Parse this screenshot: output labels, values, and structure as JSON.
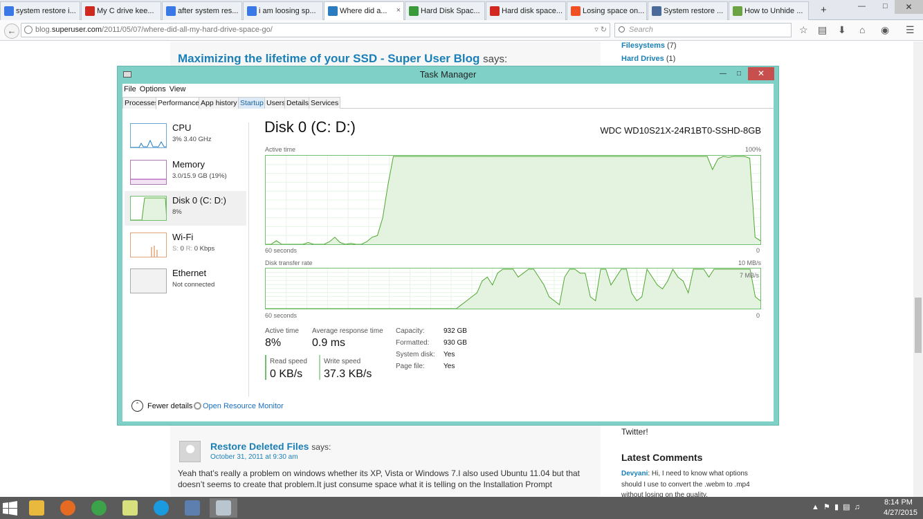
{
  "browser": {
    "tabs": [
      {
        "label": "system restore i...",
        "favicon": "google-icon",
        "color": "#3b78e7"
      },
      {
        "label": "My C drive kee...",
        "favicon": "T-icon",
        "color": "#d0281e"
      },
      {
        "label": "after system res...",
        "favicon": "google-icon",
        "color": "#3b78e7"
      },
      {
        "label": "i am loosing sp...",
        "favicon": "google-icon",
        "color": "#3b78e7"
      },
      {
        "label": "Where did a...",
        "favicon": "superuser-icon",
        "color": "#2a7bbf",
        "active": true
      },
      {
        "label": "Hard Disk Spac...",
        "favicon": "sevenforums-icon",
        "color": "#3a9a3a"
      },
      {
        "label": "Hard disk space...",
        "favicon": "T-icon",
        "color": "#d0281e"
      },
      {
        "label": "Losing space on...",
        "favicon": "microsoft-icon",
        "color": "#f25022"
      },
      {
        "label": "System restore ...",
        "favicon": "page-icon",
        "color": "#4a6b9a"
      },
      {
        "label": "How to Unhide ...",
        "favicon": "wikihow-icon",
        "color": "#6ba342"
      }
    ],
    "active_tab_close": "×",
    "new_tab": "+",
    "url_prefix": "blog.",
    "url_host": "superuser.com",
    "url_path": "/2011/05/07/where-did-all-my-hard-drive-space-go/",
    "search_placeholder": "Search"
  },
  "page": {
    "post_title": "Maximizing the lifetime of your SSD - Super User Blog",
    "post_says": "says:",
    "sidebar_filesystems": "Filesystems",
    "sidebar_filesystems_count": "(7)",
    "sidebar_harddrives": "Hard Drives",
    "sidebar_harddrives_count": "(1)",
    "sidebar_twitter": "Twitter!",
    "latest_comments_heading": "Latest Comments",
    "latest_comment_author": "Devyani",
    "latest_comment_text": ": Hi, I need to know what options should I use to convert the .webm to .mp4 without losing on the quality.",
    "comment_author": "Restore Deleted Files",
    "comment_says": "says:",
    "comment_date": "October 31, 2011 at 9:30 am",
    "comment_text": "Yeah that’s really a problem on windows whether its XP, Vista or Windows 7.I also used Ubuntu 11.04 but that doesn’t seems to create that problem.It just consume space what it is telling on the Installation Prompt"
  },
  "taskmanager": {
    "title": "Task Manager",
    "menu": [
      "File",
      "Options",
      "View"
    ],
    "tabs": [
      "Processes",
      "Performance",
      "App history",
      "Startup",
      "Users",
      "Details",
      "Services"
    ],
    "selected_tab": "Performance",
    "resources": [
      {
        "name": "CPU",
        "sub": "3%  3.40 GHz",
        "color": "#1f7bc0"
      },
      {
        "name": "Memory",
        "sub": "3.0/15.9 GB (19%)",
        "color": "#9c37a6"
      },
      {
        "name": "Disk 0 (C: D:)",
        "sub": "8%",
        "color": "#4ea72e",
        "selected": true
      },
      {
        "name": "Wi-Fi",
        "sub_s": "S:",
        "sub_s_val": "0",
        "sub_r": "R:",
        "sub_r_val": "0 Kbps",
        "color": "#d4793a"
      },
      {
        "name": "Ethernet",
        "sub": "Not connected",
        "color": "#999999"
      }
    ],
    "disk_title": "Disk 0 (C: D:)",
    "disk_model": "WDC WD10S21X-24R1BT0-SSHD-8GB",
    "graph1": {
      "label": "Active time",
      "max_label": "100%",
      "time_label": "60 seconds",
      "min_label": "0",
      "series": [
        0,
        0,
        4,
        0,
        0,
        0,
        0,
        0,
        2,
        0,
        0,
        0,
        3,
        8,
        2,
        0,
        1,
        0,
        0,
        3,
        8,
        10,
        30,
        68,
        100,
        100,
        100,
        100,
        100,
        100,
        100,
        100,
        100,
        100,
        100,
        100,
        100,
        100,
        100,
        100,
        100,
        100,
        100,
        100,
        100,
        100,
        100,
        100,
        100,
        100,
        100,
        100,
        100,
        100,
        100,
        100,
        100,
        100,
        100,
        100,
        100,
        100,
        100,
        100,
        100,
        100,
        100,
        100,
        100,
        100,
        100,
        100,
        100,
        100,
        100,
        100,
        100,
        100,
        100,
        100,
        100,
        100,
        100,
        100,
        85,
        97,
        100,
        99,
        100,
        100,
        100,
        98,
        8,
        4
      ]
    },
    "graph2": {
      "label": "Disk transfer rate",
      "max_label": "10 MB/s",
      "inner_label": "7 MB/s",
      "time_label": "60 seconds",
      "min_label": "0",
      "series": [
        0,
        0,
        0,
        0,
        0,
        0,
        0,
        0,
        0,
        0,
        0,
        0,
        0,
        0,
        0,
        0,
        0,
        0,
        0,
        0,
        0,
        0,
        0,
        0,
        0,
        0,
        0,
        0,
        0,
        0,
        0,
        0,
        0,
        0,
        0,
        0,
        0,
        0,
        1,
        2,
        3,
        4,
        7,
        8,
        6,
        9,
        10,
        10,
        10,
        8,
        9,
        10,
        10,
        8,
        6,
        3,
        2,
        1,
        8,
        10,
        10,
        9,
        9,
        3,
        2,
        10,
        10,
        6,
        8,
        10,
        10,
        4,
        2,
        3,
        10,
        8,
        6,
        5,
        7,
        10,
        8,
        7,
        4,
        10,
        10,
        10,
        8,
        10,
        10,
        10,
        10,
        10,
        10,
        10,
        10,
        3,
        2
      ]
    },
    "stats": {
      "active_time_label": "Active time",
      "active_time_value": "8%",
      "avg_response_label": "Average response time",
      "avg_response_value": "0.9 ms",
      "read_speed_label": "Read speed",
      "read_speed_value": "0 KB/s",
      "write_speed_label": "Write speed",
      "write_speed_value": "37.3 KB/s",
      "capacity_label": "Capacity:",
      "capacity_value": "932 GB",
      "formatted_label": "Formatted:",
      "formatted_value": "930 GB",
      "system_disk_label": "System disk:",
      "system_disk_value": "Yes",
      "page_file_label": "Page file:",
      "page_file_value": "Yes"
    },
    "fewer_details": "Fewer details",
    "open_resource_monitor": "Open Resource Monitor"
  },
  "taskbar": {
    "apps": [
      {
        "name": "file-explorer-icon",
        "color": "#e8b93c"
      },
      {
        "name": "firefox-icon",
        "color": "#e46b21"
      },
      {
        "name": "chrome-icon",
        "color": "#3ca34a"
      },
      {
        "name": "sticky-notes-icon",
        "color": "#d7e07c"
      },
      {
        "name": "skype-icon",
        "color": "#1a9be0"
      },
      {
        "name": "network-icon",
        "color": "#5d7fb0"
      },
      {
        "name": "task-manager-icon",
        "color": "#b9c6cf",
        "active": true
      }
    ],
    "clock_time": "8:14 PM",
    "clock_date": "4/27/2015"
  }
}
